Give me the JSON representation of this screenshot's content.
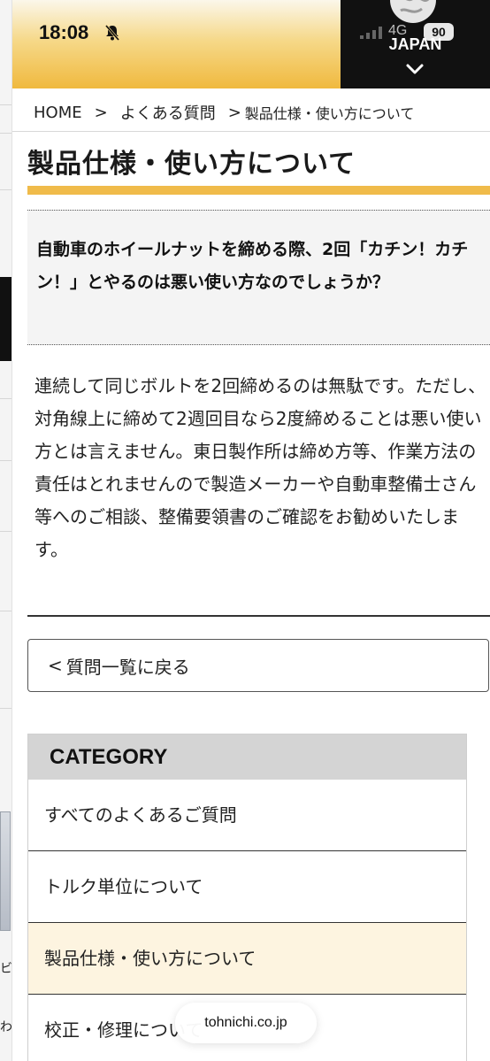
{
  "status_bar": {
    "time": "18:08",
    "network": "4G",
    "battery": "90"
  },
  "header": {
    "language": "JAPAN"
  },
  "breadcrumb": {
    "home": "HOME",
    "sep": ">",
    "faq": "よくある質問",
    "current": "製品仕様・使い方について"
  },
  "page": {
    "title": "製品仕様・使い方について"
  },
  "question": {
    "text": "自動車のホイールナットを締める際、2回「カチン！カチン！」とやるのは悪い使い方なのでしょうか？"
  },
  "answer": {
    "text": "連続して同じボルトを2回締めるのは無駄です。ただし、対角線上に締めて2週回目なら2度締めることは悪い使い方とは言えません。東日製作所は締め方等、作業方法の責任はとれませんので製造メーカーや自動車整備士さん等へのご相談、整備要領書のご確認をお勧めいたします。"
  },
  "back_button": {
    "lt": "<",
    "label": "質問一覧に戻る"
  },
  "category": {
    "header": "CATEGORY",
    "items": [
      {
        "label": "すべてのよくあるご質問"
      },
      {
        "label": "トルク単位について"
      },
      {
        "label": "製品仕様・使い方について"
      },
      {
        "label": "校正・修理について"
      }
    ]
  },
  "browser": {
    "url": "tohnichi.co.jp"
  },
  "colors": {
    "accent": "#f0bb4a",
    "active_item": "#fdf4e0"
  }
}
